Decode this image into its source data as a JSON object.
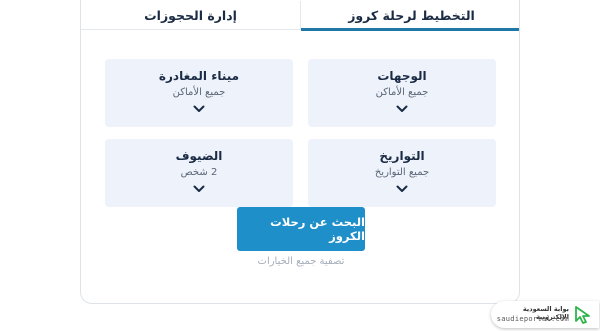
{
  "tabs": [
    {
      "label": "التخطيط لرحلة كروز",
      "active": true
    },
    {
      "label": "إدارة الحجوزات",
      "active": false
    }
  ],
  "fields": {
    "destinations": {
      "label": "الوجهات",
      "value": "جميع الأماكن"
    },
    "departure_port": {
      "label": "ميناء المغادرة",
      "value": "جميع الأماكن"
    },
    "dates": {
      "label": "التواريخ",
      "value": "جميع التواريخ"
    },
    "guests": {
      "label": "الضيوف",
      "value": "2 شخص"
    }
  },
  "search_button": "البحث عن رحلات الكروز",
  "reset_link": "تصفية جميع الخيارات",
  "badge": {
    "arabic": "بوابة السعودية الإلكترونية",
    "latin": "saudieportal.com"
  },
  "icons": {
    "chevron": "chevron-down-icon",
    "cursor": "cursor-arrow-icon"
  },
  "colors": {
    "accent": "#1f8fc9",
    "tab_underline": "#1f77a8",
    "field_bg": "#edf2fb",
    "text_dark": "#1b2b44",
    "cursor_green": "#2fb34a"
  }
}
